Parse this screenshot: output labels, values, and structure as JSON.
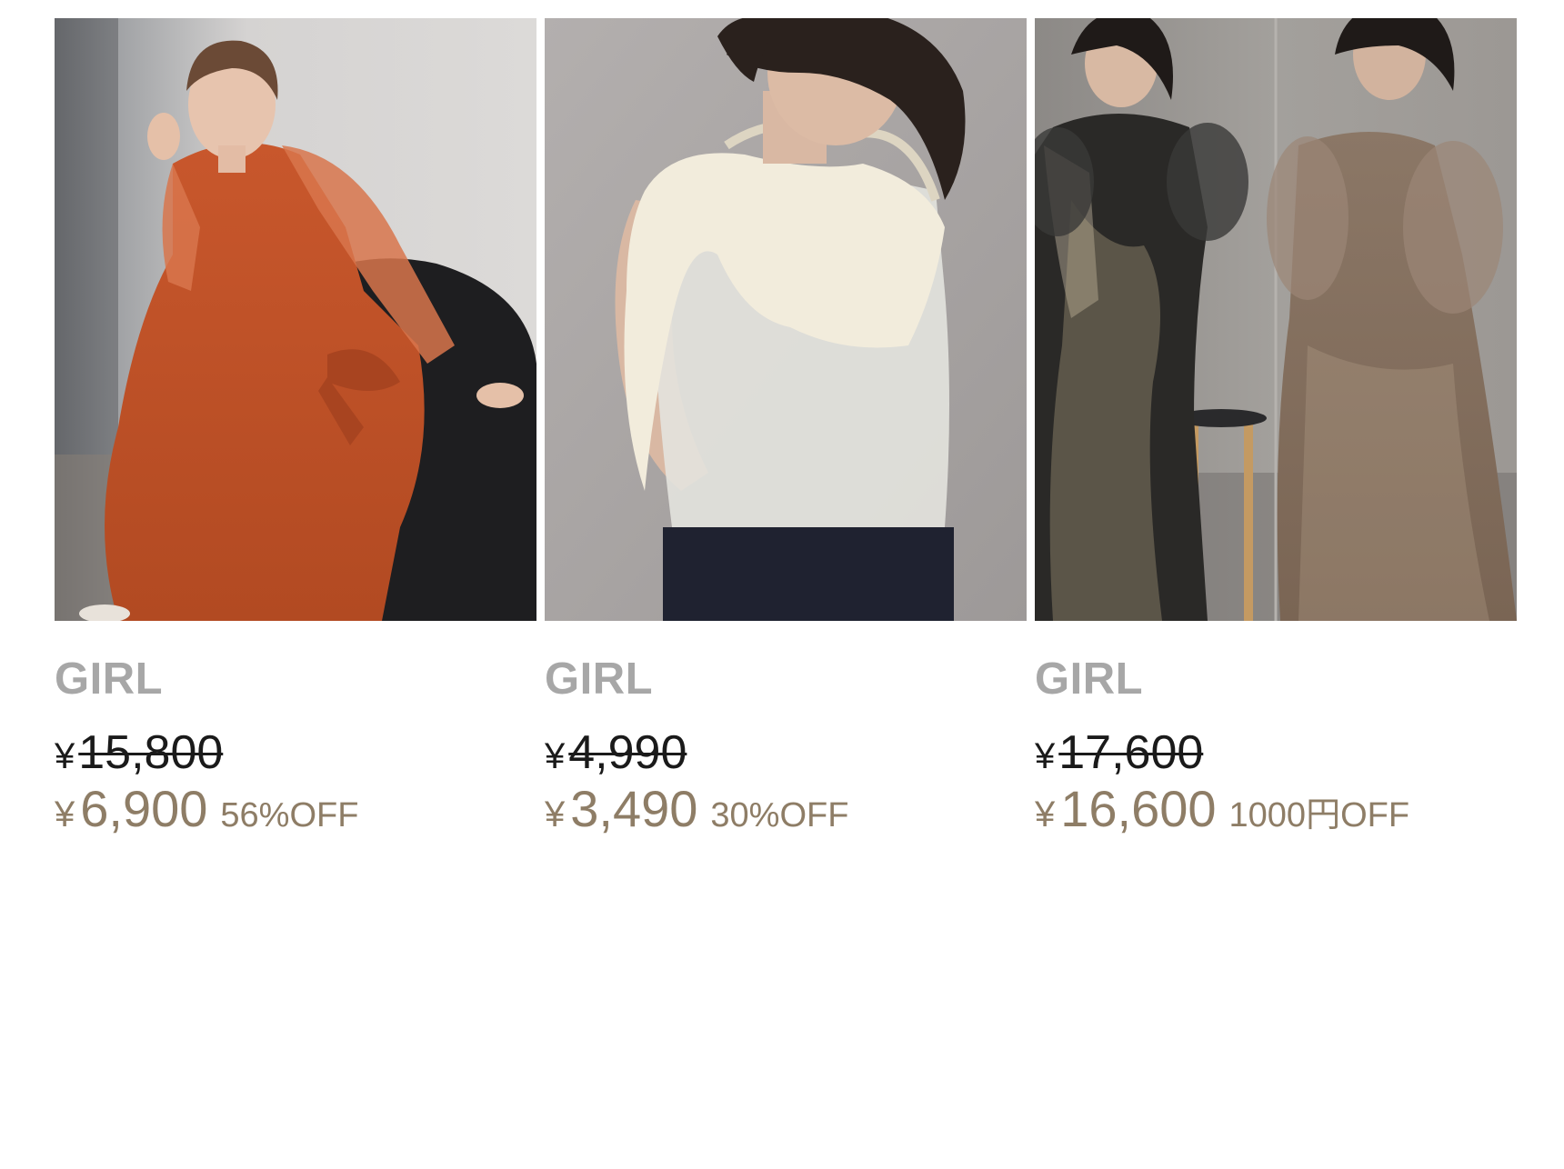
{
  "products": [
    {
      "brand": "GIRL",
      "currency": "¥",
      "original_price": "15,800",
      "sale_price": "6,900",
      "discount": "56%OFF",
      "image": "orange-lace-sleeve-dress-photo"
    },
    {
      "brand": "GIRL",
      "currency": "¥",
      "original_price": "4,990",
      "sale_price": "3,490",
      "discount": "30%OFF",
      "image": "ivory-ruffle-sheer-top-photo"
    },
    {
      "brand": "GIRL",
      "currency": "¥",
      "original_price": "17,600",
      "sale_price": "16,600",
      "discount": "1000円OFF",
      "image": "embroidered-tulle-dress-photo"
    }
  ],
  "colors": {
    "brand_text": "#a7a7a7",
    "original_price": "#1a1a1a",
    "sale_price": "#8e7d66",
    "background": "#ffffff"
  }
}
